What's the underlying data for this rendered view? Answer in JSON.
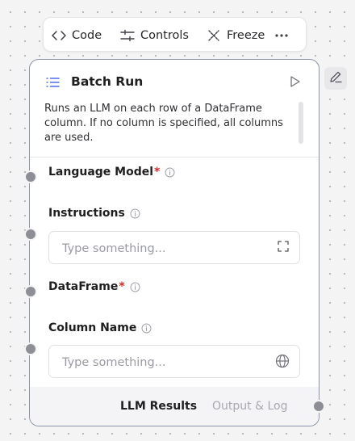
{
  "toolbar": {
    "code_label": "Code",
    "controls_label": "Controls",
    "freeze_label": "Freeze"
  },
  "node": {
    "title": "Batch Run",
    "description": "Runs an LLM on each row of a DataFrame column. If no column is specified, all columns are used.",
    "fields": {
      "language_model": {
        "label": "Language Model",
        "required_mark": "*"
      },
      "instructions": {
        "label": "Instructions",
        "placeholder": "Type something..."
      },
      "dataframe": {
        "label": "DataFrame",
        "required_mark": "*"
      },
      "column_name": {
        "label": "Column Name",
        "placeholder": "Type something..."
      }
    },
    "footer": {
      "output_tab": "LLM Results",
      "log_tab": "Output & Log"
    }
  },
  "colors": {
    "required": "#dc2626",
    "node_border": "#8b93a8",
    "accent_icon": "#4f6bed"
  }
}
